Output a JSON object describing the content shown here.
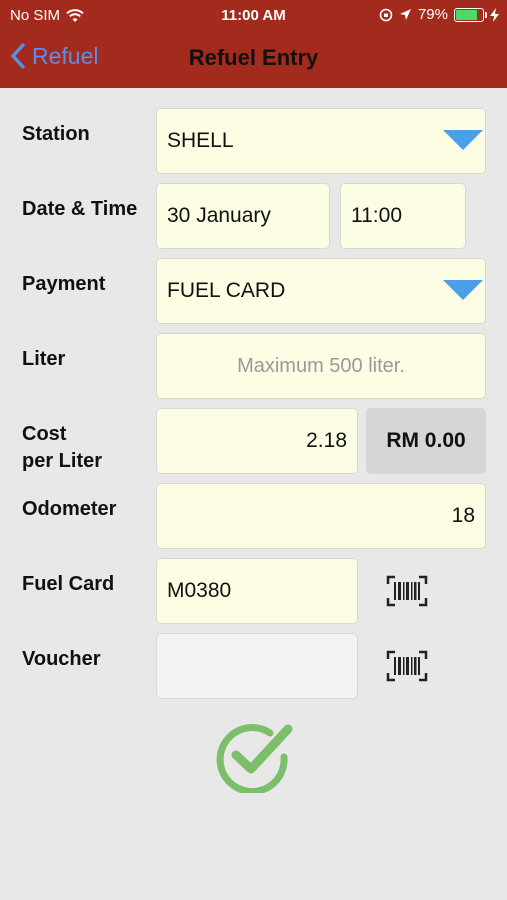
{
  "status_bar": {
    "carrier": "No SIM",
    "time": "11:00 AM",
    "battery": "79%",
    "battery_level": 0.79
  },
  "nav": {
    "back_label": "Refuel",
    "title": "Refuel Entry"
  },
  "form": {
    "station": {
      "label": "Station",
      "value": "SHELL"
    },
    "datetime": {
      "label": "Date & Time",
      "date": "30 January",
      "time": "11:00"
    },
    "payment": {
      "label": "Payment",
      "value": "FUEL CARD"
    },
    "liter": {
      "label": "Liter",
      "placeholder": "Maximum 500 liter."
    },
    "cost": {
      "label_line1": "Cost",
      "label_line2": "per Liter",
      "value": "2.18",
      "total": "RM 0.00"
    },
    "odometer": {
      "label": "Odometer",
      "value": "18"
    },
    "fuel_card": {
      "label": "Fuel Card",
      "value": "M0380"
    },
    "voucher": {
      "label": "Voucher",
      "value": ""
    }
  },
  "colors": {
    "header": "#a22b1d",
    "accent_blue": "#5b8ee4",
    "field_bg": "#fdfde4",
    "confirm_green": "#7bbf6a"
  },
  "icons": {
    "back": "chevron-left-icon",
    "dropdown": "triangle-down-icon",
    "barcode": "barcode-scan-icon",
    "confirm": "check-circle-icon"
  }
}
